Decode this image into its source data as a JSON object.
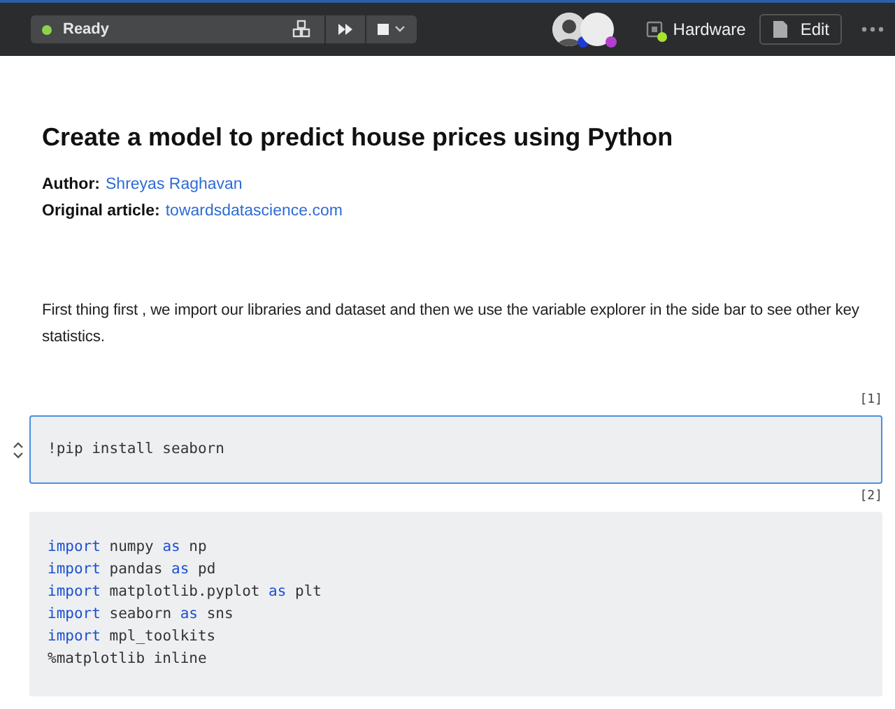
{
  "toolbar": {
    "status": {
      "label": "Ready",
      "color": "#8fd14f"
    },
    "hardware": {
      "label": "Hardware",
      "color": "#a6e22e"
    },
    "edit_button": "Edit",
    "avatars": [
      {
        "kind": "photo",
        "color": "#1f3bd1"
      },
      {
        "kind": "blank",
        "color": "#b23fd0"
      }
    ]
  },
  "title": "Create a model to predict house prices using Python",
  "meta": [
    {
      "label": "Author:",
      "value": "Shreyas Raghavan"
    },
    {
      "label": "Original article:",
      "value": "towardsdatascience.com"
    }
  ],
  "paragraph": "First thing first , we import our libraries and dataset and then we use the variable explorer in the side bar to see other key statistics.",
  "cells": [
    {
      "count": "[1]",
      "selected": true,
      "lines": [
        [
          {
            "text": "!pip install seaborn",
            "kind": "plain"
          }
        ]
      ]
    },
    {
      "count": "[2]",
      "selected": false,
      "lines": [
        [
          {
            "text": "import",
            "kind": "keyword"
          },
          {
            "text": " numpy ",
            "kind": "plain"
          },
          {
            "text": "as",
            "kind": "keyword"
          },
          {
            "text": " np",
            "kind": "plain"
          }
        ],
        [
          {
            "text": "import",
            "kind": "keyword"
          },
          {
            "text": " pandas ",
            "kind": "plain"
          },
          {
            "text": "as",
            "kind": "keyword"
          },
          {
            "text": " pd",
            "kind": "plain"
          }
        ],
        [
          {
            "text": "import",
            "kind": "keyword"
          },
          {
            "text": " matplotlib.pyplot ",
            "kind": "plain"
          },
          {
            "text": "as",
            "kind": "keyword"
          },
          {
            "text": " plt",
            "kind": "plain"
          }
        ],
        [
          {
            "text": "import",
            "kind": "keyword"
          },
          {
            "text": " seaborn ",
            "kind": "plain"
          },
          {
            "text": "as",
            "kind": "keyword"
          },
          {
            "text": " sns",
            "kind": "plain"
          }
        ],
        [
          {
            "text": "import",
            "kind": "keyword"
          },
          {
            "text": " mpl_toolkits",
            "kind": "plain"
          }
        ],
        [
          {
            "text": "%matplotlib inline",
            "kind": "plain"
          }
        ]
      ]
    }
  ]
}
